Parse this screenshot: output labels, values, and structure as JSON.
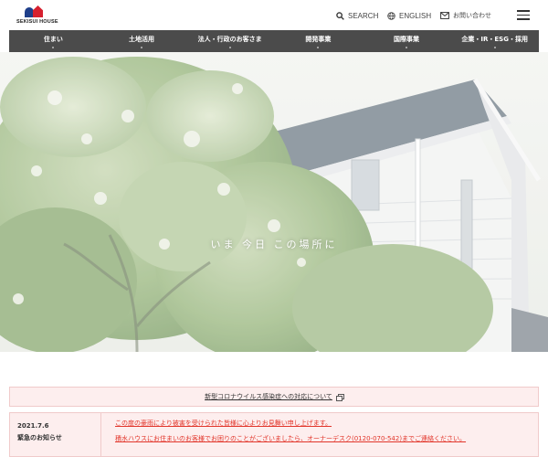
{
  "brand": {
    "logo_text": "SEKISUI HOUSE"
  },
  "header": {
    "search_label": "SEARCH",
    "english_label": "ENGLISH",
    "contact_label": "お問い合わせ"
  },
  "nav": {
    "items": [
      {
        "label": "住まい"
      },
      {
        "label": "土地活用"
      },
      {
        "label": "法人・行政のお客さま"
      },
      {
        "label": "開発事業"
      },
      {
        "label": "国際事業"
      },
      {
        "label": "企業・IR・ESG・採用"
      }
    ]
  },
  "hero": {
    "copy": "いま 今日 この場所に"
  },
  "notice": {
    "label": "新型コロナウイルス感染症への対応について"
  },
  "news": {
    "date": "2021.7.6",
    "label": "緊急のお知らせ",
    "line1": "この度の豪雨により被害を受けられた皆様に心よりお見舞い申し上げます。",
    "line2": "積水ハウスにお住まいのお客様でお困りのことがございましたら、オーナーデスク(0120-070-542)までご連絡ください。"
  },
  "colors": {
    "nav_bg": "#4b4b4b",
    "notice_bg": "#fdeeee",
    "news_link": "#e2362b",
    "logo_blue": "#1f3f8a",
    "logo_red": "#d6202f"
  }
}
